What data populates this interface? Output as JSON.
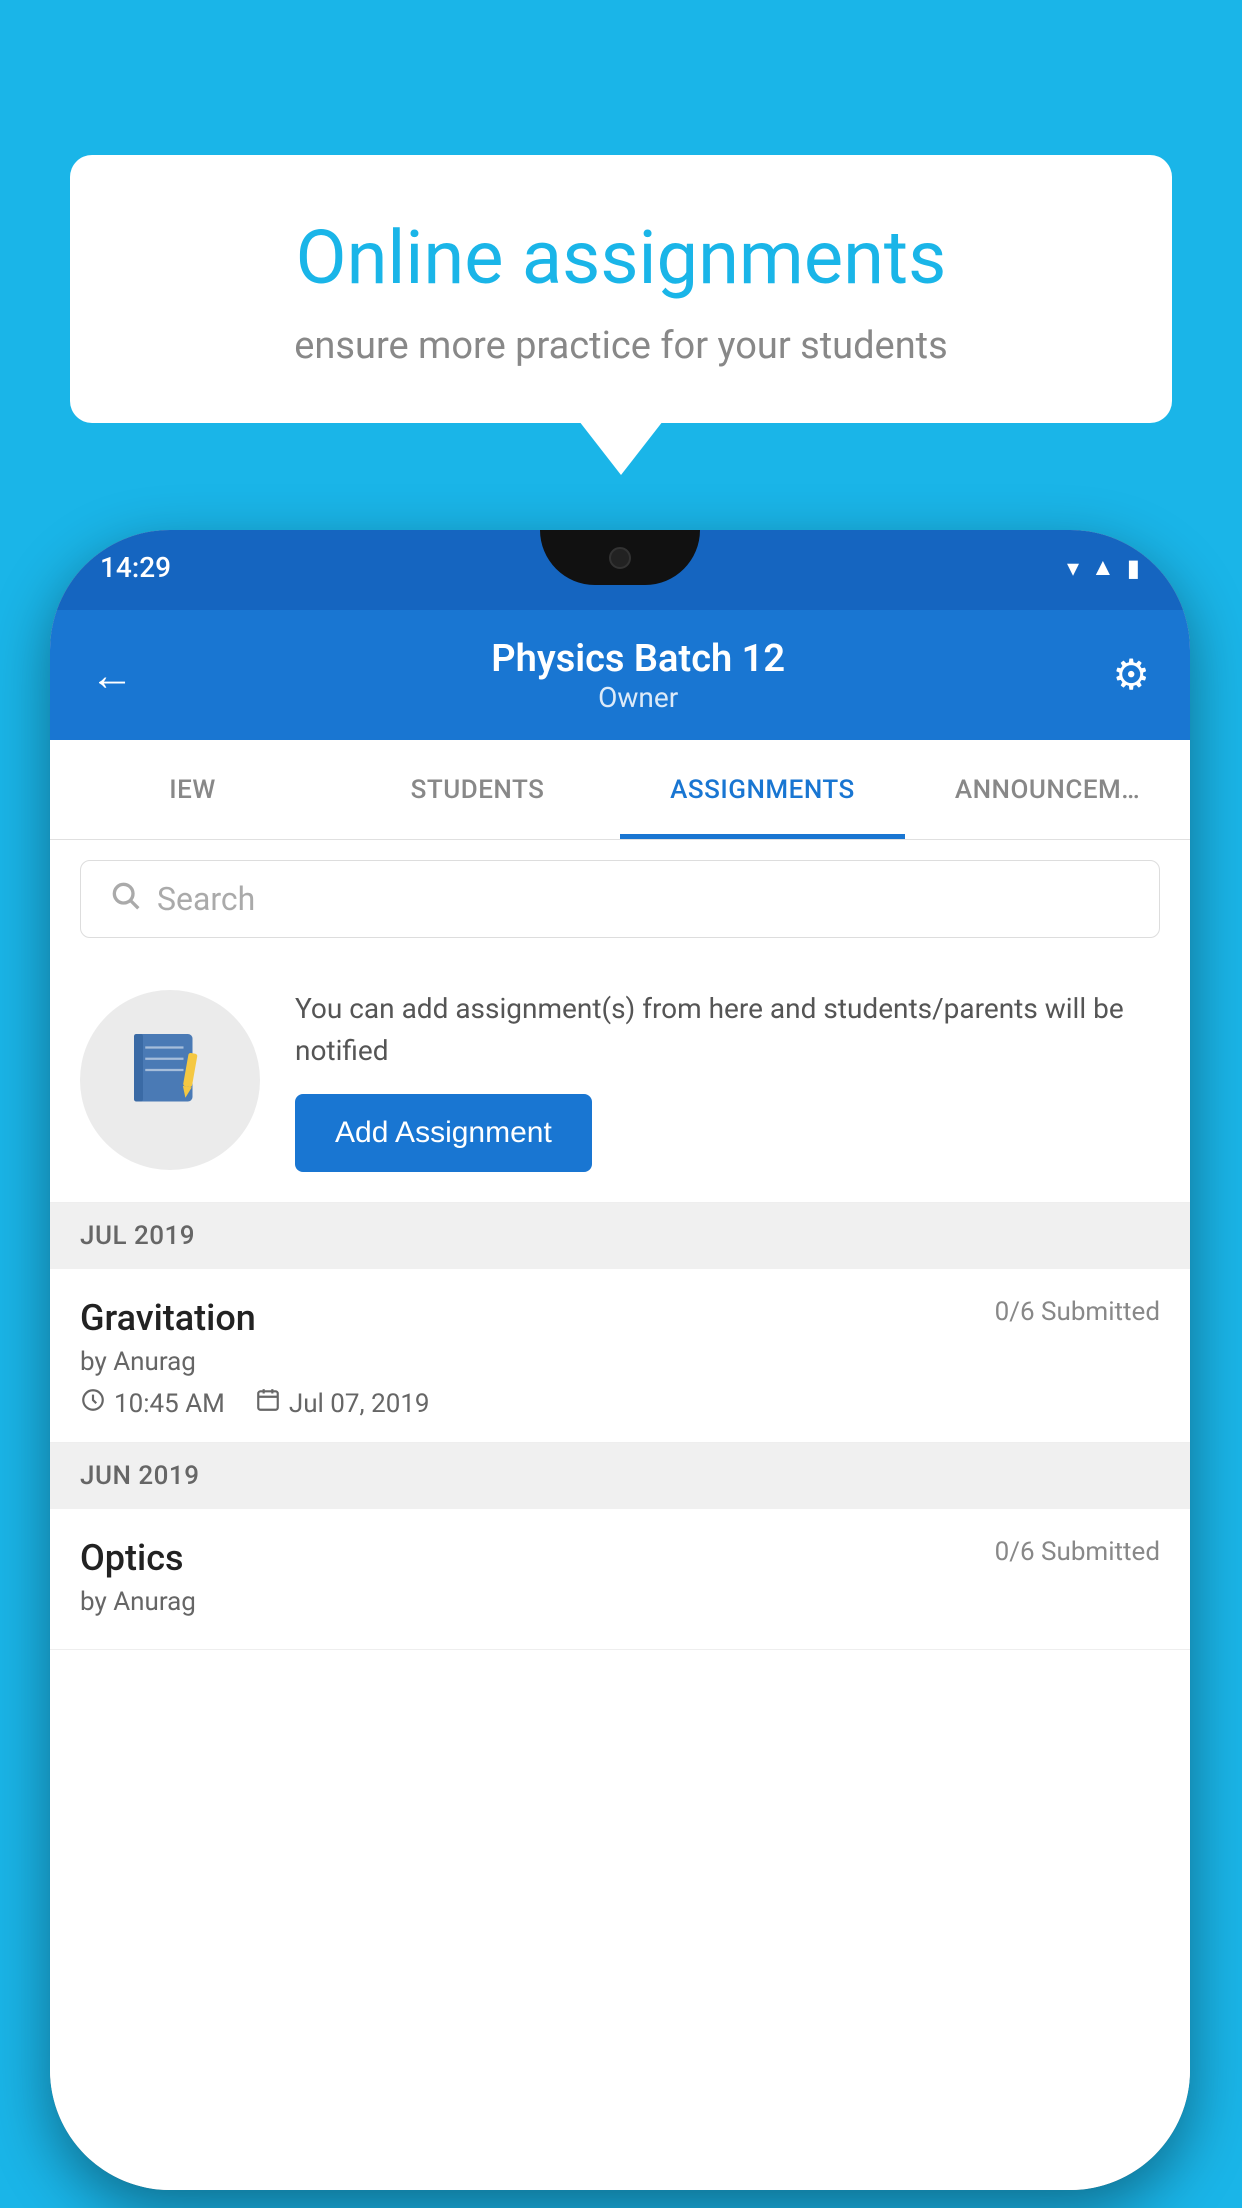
{
  "background_color": "#1ab5e8",
  "speech_bubble": {
    "title": "Online assignments",
    "subtitle": "ensure more practice for your students"
  },
  "status_bar": {
    "time": "14:29",
    "icons": [
      "wifi",
      "signal",
      "battery"
    ]
  },
  "app_bar": {
    "title": "Physics Batch 12",
    "subtitle": "Owner",
    "back_label": "←",
    "settings_label": "⚙"
  },
  "tabs": [
    {
      "label": "IEW",
      "active": false
    },
    {
      "label": "STUDENTS",
      "active": false
    },
    {
      "label": "ASSIGNMENTS",
      "active": true
    },
    {
      "label": "ANNOUNCEM…",
      "active": false
    }
  ],
  "search": {
    "placeholder": "Search"
  },
  "info_card": {
    "description": "You can add assignment(s) from here and students/parents will be notified",
    "button_label": "Add Assignment"
  },
  "sections": [
    {
      "header": "JUL 2019",
      "assignments": [
        {
          "name": "Gravitation",
          "submitted": "0/6 Submitted",
          "author": "by Anurag",
          "time": "10:45 AM",
          "date": "Jul 07, 2019"
        }
      ]
    },
    {
      "header": "JUN 2019",
      "assignments": [
        {
          "name": "Optics",
          "submitted": "0/6 Submitted",
          "author": "by Anurag",
          "time": "",
          "date": ""
        }
      ]
    }
  ]
}
